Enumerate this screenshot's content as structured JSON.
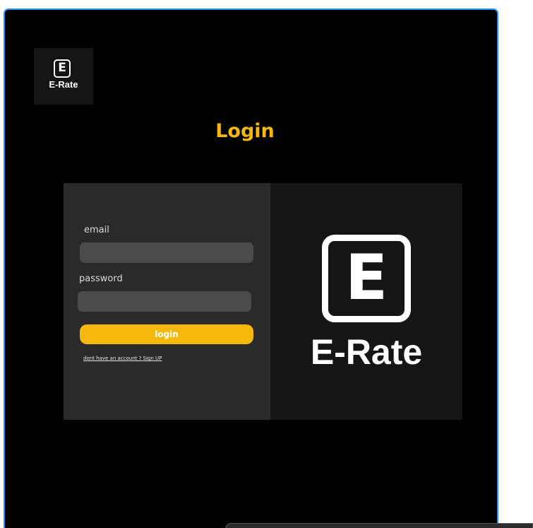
{
  "brand": {
    "icon_letter": "E",
    "name": "E-Rate"
  },
  "page": {
    "title": "Login"
  },
  "form": {
    "email_label": "email",
    "email_value": "",
    "password_label": "password",
    "password_value": "",
    "login_label": "login",
    "signup_link": "dont have an account ? Sign UP"
  },
  "colors": {
    "accent": "#f5b80c",
    "window_border": "#2a8df0",
    "background": "#000000"
  }
}
